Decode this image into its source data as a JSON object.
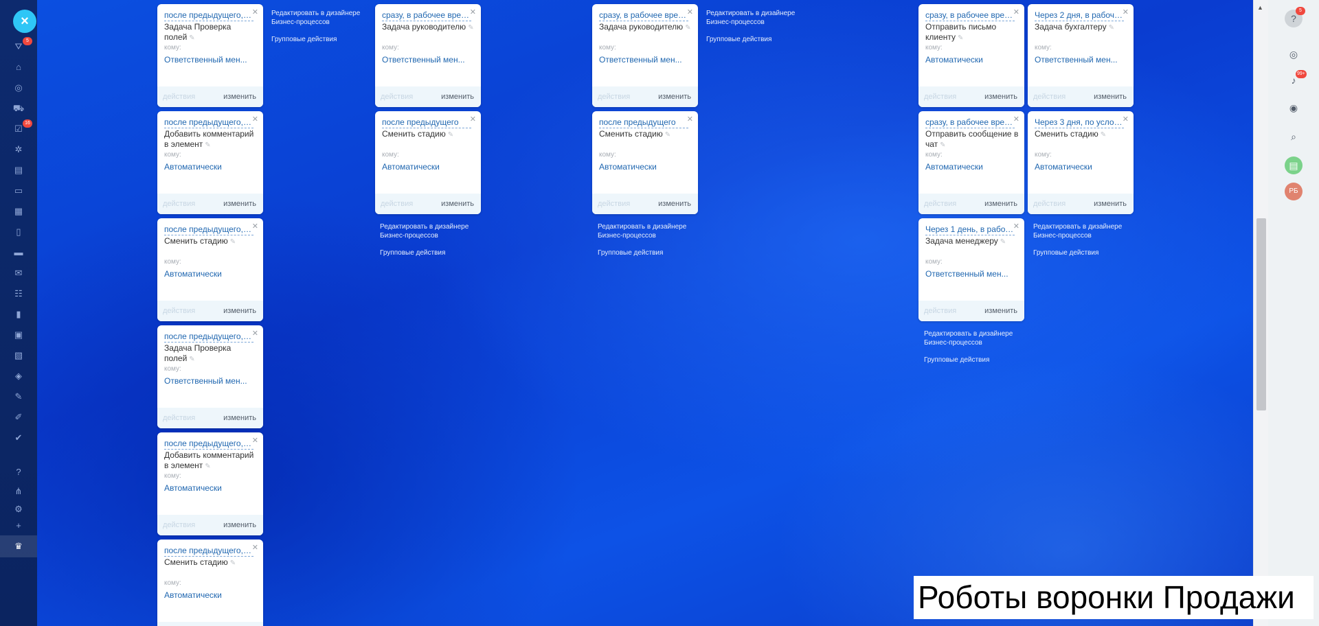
{
  "sidebar": {
    "close_icon": "×",
    "filter_badge": "5",
    "tasks_badge": "16"
  },
  "right_panel": {
    "help_badge": "5",
    "notifications_badge": "99+",
    "avatar_initials": "РБ"
  },
  "labels": {
    "to": "кому:",
    "actions": "действия",
    "edit": "изменить",
    "designer_link": "Редактировать в дизайнере Бизнес-процессов",
    "group_actions": "Групповые действия"
  },
  "caption": "Роботы воронки Продажи",
  "columns": [
    {
      "cards": [
        {
          "condition": "после предыдущего, п...",
          "title": "Задача Проверка полей",
          "assignee": "Ответственный мен..."
        },
        {
          "condition": "после предыдущего, п...",
          "title": "Добавить комментарий в элемент",
          "assignee": "Автоматически"
        },
        {
          "condition": "после предыдущего, п...",
          "title": "Сменить стадию",
          "assignee": "Автоматически"
        },
        {
          "condition": "после предыдущего, п...",
          "title": "Задача Проверка полей",
          "assignee": "Ответственный мен..."
        },
        {
          "condition": "после предыдущего, п...",
          "title": "Добавить комментарий в элемент",
          "assignee": "Автоматически"
        },
        {
          "condition": "после предыдущего, п...",
          "title": "Сменить стадию",
          "assignee": "Автоматически"
        }
      ]
    },
    {
      "cards": [
        {
          "condition": "сразу, в рабочее врем...",
          "title": "Задача руководителю",
          "assignee": "Ответственный мен..."
        },
        {
          "condition": "после предыдущего",
          "title": "Сменить стадию",
          "assignee": "Автоматически"
        }
      ]
    },
    {
      "cards": [
        {
          "condition": "сразу, в рабочее врем...",
          "title": "Задача руководителю",
          "assignee": "Ответственный мен..."
        },
        {
          "condition": "после предыдущего",
          "title": "Сменить стадию",
          "assignee": "Автоматически"
        }
      ]
    },
    {
      "cards": [
        {
          "condition": "сразу, в рабочее врем...",
          "title": "Отправить письмо клиенту",
          "assignee": "Автоматически"
        },
        {
          "condition": "сразу, в рабочее врем...",
          "title": "Отправить сообщение в чат",
          "assignee": "Автоматически"
        },
        {
          "condition": "Через 1 день, в рабоч...",
          "title": "Задача менеджеру",
          "assignee": "Ответственный мен..."
        }
      ]
    },
    {
      "cards": [
        {
          "condition": "Через 2 дня, в рабоче...",
          "title": "Задача бухгалтеру",
          "assignee": "Ответственный мен..."
        },
        {
          "condition": "Через 3 дня, по услов...",
          "title": "Сменить стадию",
          "assignee": "Автоматически"
        }
      ]
    }
  ]
}
